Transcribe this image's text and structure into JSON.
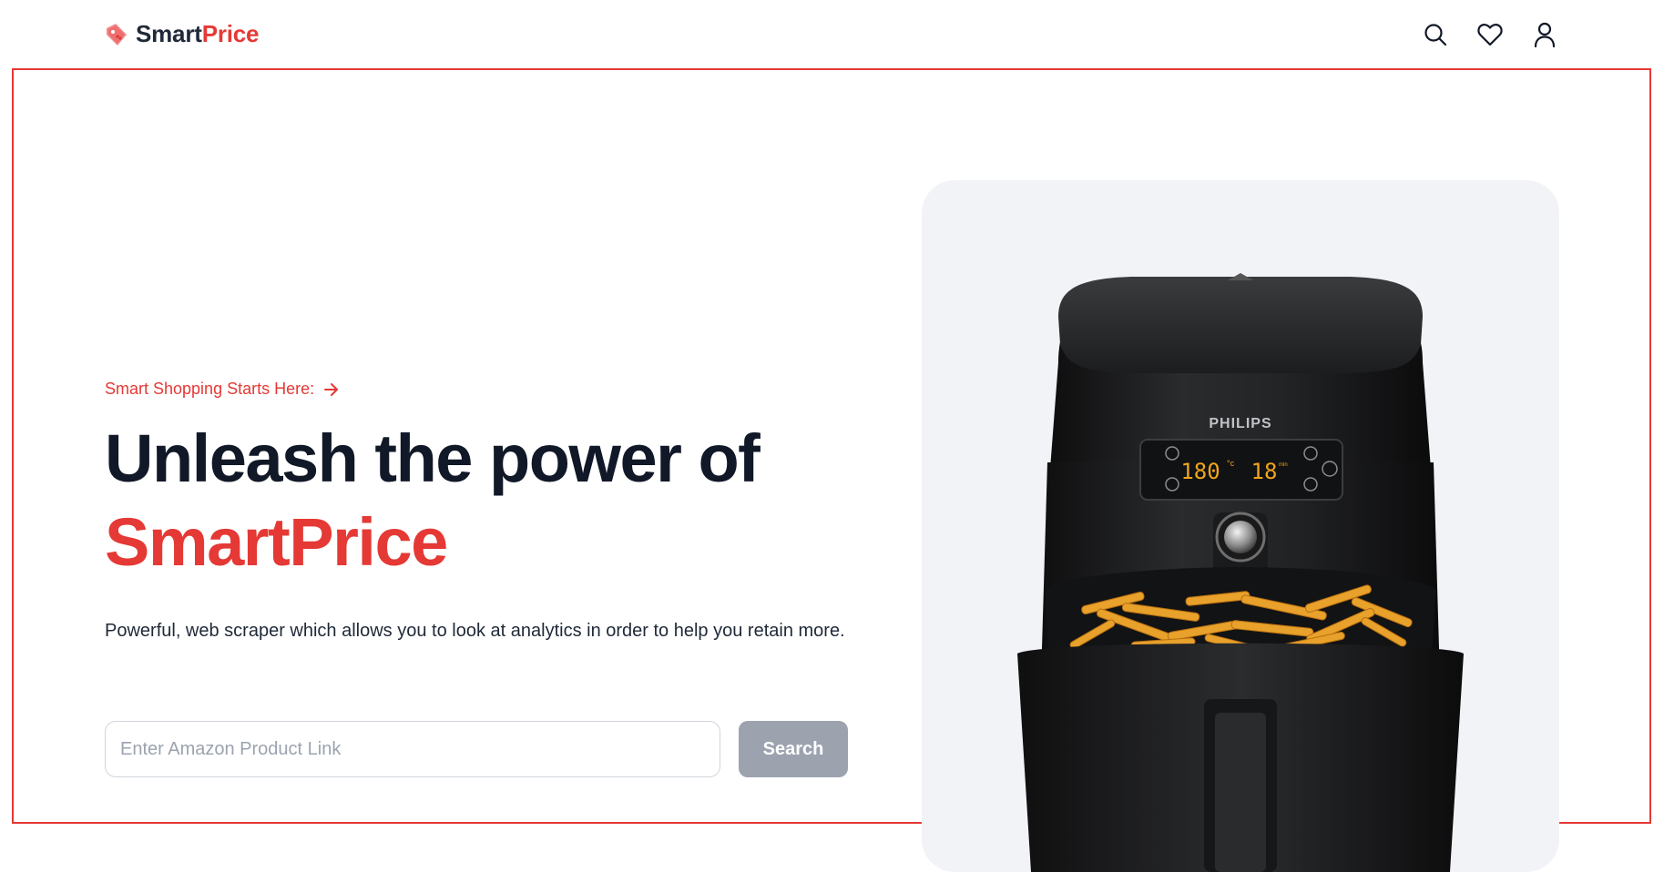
{
  "brand": {
    "part1": "Smart",
    "part2": "Price"
  },
  "nav": {
    "icons": [
      "search-icon",
      "heart-icon",
      "user-icon"
    ]
  },
  "hero": {
    "kicker": "Smart Shopping Starts Here:",
    "headline_line1": "Unleash the power of",
    "headline_line2": "SmartPrice",
    "description": "Powerful, web scraper which allows you to look at analytics in order to help you retain more.",
    "search_placeholder": "Enter Amazon Product Link",
    "search_button": "Search"
  },
  "product_image": {
    "brand_label": "PHILIPS",
    "display_temp": "180",
    "display_temp_unit": "°c",
    "display_time": "18",
    "display_time_unit": "min"
  },
  "colors": {
    "accent": "#e53935",
    "heading": "#111827",
    "panel": "#f2f3f6",
    "button_disabled": "#9ca3af"
  }
}
